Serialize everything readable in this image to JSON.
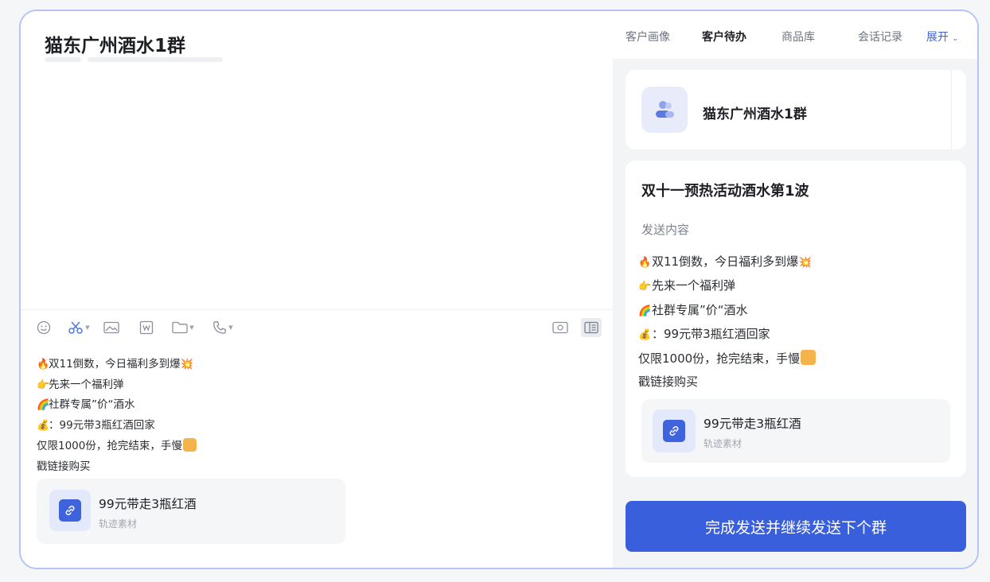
{
  "chat": {
    "title": "猫东广州酒水1群",
    "message_lines": [
      {
        "icon": "fire-icon",
        "emoji": "🔥",
        "text": "双11倒数，今日福利多到爆",
        "trail": "💥"
      },
      {
        "icon": "pointing-hand-icon",
        "emoji": "👉",
        "text": "先来一个福利弹"
      },
      {
        "icon": "rainbow-icon",
        "emoji": "🌈",
        "text": "社群专属”价“酒水"
      },
      {
        "icon": "money-bag-icon",
        "emoji": "💰",
        "text": "：99元带3瓶红酒回家"
      },
      {
        "text": "仅限1000份，抢完结束，手慢"
      },
      {
        "text": "戳链接购买"
      }
    ],
    "attachment": {
      "title": "99元带走3瓶红酒",
      "subtitle": "轨迹素材"
    }
  },
  "toolbar": {
    "items": [
      "emoji-icon",
      "scissors-icon",
      "image-icon",
      "word-doc-icon",
      "folder-icon",
      "phone-icon",
      "screen-record-icon",
      "layout-toggle-icon"
    ]
  },
  "right_panel": {
    "tabs": [
      {
        "label": "客户画像",
        "active": false
      },
      {
        "label": "客户待办",
        "active": true
      },
      {
        "label": "商品库",
        "active": false
      },
      {
        "label": "会话记录",
        "active": false
      }
    ],
    "expand_label": "展开",
    "group": {
      "name": "猫东广州酒水1群"
    },
    "task": {
      "title": "双十一预热活动酒水第1波",
      "send_label": "发送内容",
      "attachment": {
        "title": "99元带走3瓶红酒",
        "subtitle": "轨迹素材"
      }
    },
    "primary_button": "完成发送并继续发送下个群"
  },
  "colors": {
    "accent": "#3a5fdc",
    "border": "#b6c4f3"
  }
}
